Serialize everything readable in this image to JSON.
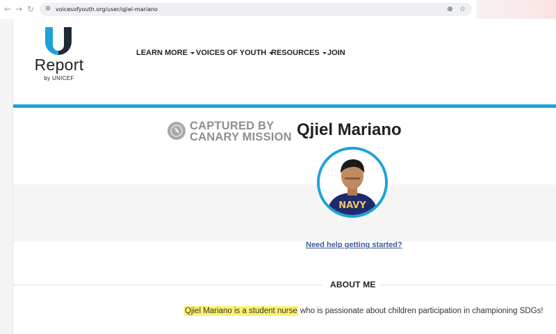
{
  "browser": {
    "url": "voicesofyouth.org/user/qjiel-mariano",
    "back_icon": "arrow-left-icon",
    "forward_icon": "arrow-right-icon",
    "reload_icon": "reload-icon",
    "zoom_icon": "zoom-icon",
    "bookmark_icon": "star-icon"
  },
  "header": {
    "logo": {
      "word": "Report",
      "byline": "by UNICEF",
      "accent_color": "#1ba3d8"
    },
    "nav": [
      {
        "label": "LEARN MORE",
        "has_dropdown": true
      },
      {
        "label": "VOICES OF YOUTH",
        "has_dropdown": true
      },
      {
        "label": "RESOURCES",
        "has_dropdown": true
      },
      {
        "label": "JOIN",
        "has_dropdown": false
      }
    ]
  },
  "watermark": {
    "line1": "CAPTURED BY",
    "line2": "CANARY MISSION"
  },
  "profile": {
    "name": "Qjiel Mariano",
    "shirt_text": "NAVY",
    "help_link": "Need help getting started?"
  },
  "about": {
    "title": "ABOUT ME",
    "bio_highlight": "Qjiel Mariano is a student nurse",
    "bio_rest": " who is passionate about children participation in championing SDGs!",
    "highlight_color": "#fbf36b"
  }
}
